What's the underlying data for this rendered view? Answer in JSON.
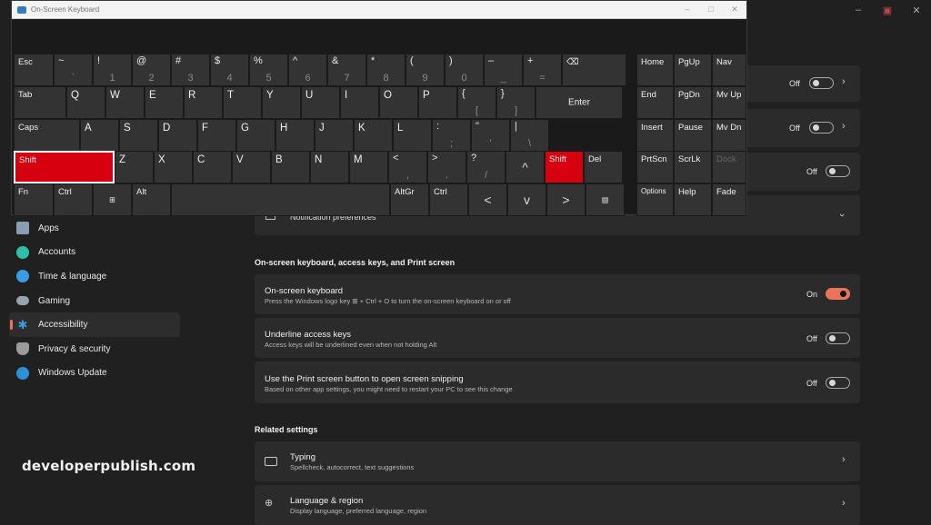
{
  "osk": {
    "title": "On-Screen Keyboard",
    "controls": {
      "minimize": "–",
      "maximize": "□",
      "close": "✕"
    },
    "rows": [
      [
        {
          "label": "Esc"
        },
        {
          "upper": "~",
          "lower": "`"
        },
        {
          "upper": "!",
          "lower": "1"
        },
        {
          "upper": "@",
          "lower": "2"
        },
        {
          "upper": "#",
          "lower": "3"
        },
        {
          "upper": "$",
          "lower": "4"
        },
        {
          "upper": "%",
          "lower": "5"
        },
        {
          "upper": "^",
          "lower": "6"
        },
        {
          "upper": "&",
          "lower": "7"
        },
        {
          "upper": "*",
          "lower": "8"
        },
        {
          "upper": "(",
          "lower": "9"
        },
        {
          "upper": ")",
          "lower": "0"
        },
        {
          "upper": "–",
          "lower": "_"
        },
        {
          "upper": "+",
          "lower": "="
        },
        {
          "label": "⌫",
          "icon": "backspace-icon"
        }
      ],
      [
        {
          "label": "Tab"
        },
        {
          "label": "Q"
        },
        {
          "label": "W"
        },
        {
          "label": "E"
        },
        {
          "label": "R"
        },
        {
          "label": "T"
        },
        {
          "label": "Y"
        },
        {
          "label": "U"
        },
        {
          "label": "I"
        },
        {
          "label": "O"
        },
        {
          "label": "P"
        },
        {
          "upper": "{",
          "lower": "["
        },
        {
          "upper": "}",
          "lower": "]"
        },
        {
          "label": "Enter"
        }
      ],
      [
        {
          "label": "Caps"
        },
        {
          "label": "A"
        },
        {
          "label": "S"
        },
        {
          "label": "D"
        },
        {
          "label": "F"
        },
        {
          "label": "G"
        },
        {
          "label": "H"
        },
        {
          "label": "J"
        },
        {
          "label": "K"
        },
        {
          "label": "L"
        },
        {
          "upper": ":",
          "lower": ";"
        },
        {
          "upper": "\"",
          "lower": "'"
        },
        {
          "upper": "|",
          "lower": "\\"
        }
      ],
      [
        {
          "label": "Shift",
          "state": "pressed"
        },
        {
          "label": "Z"
        },
        {
          "label": "X"
        },
        {
          "label": "C"
        },
        {
          "label": "V"
        },
        {
          "label": "B"
        },
        {
          "label": "N"
        },
        {
          "label": "M"
        },
        {
          "upper": "<",
          "lower": ","
        },
        {
          "upper": ">",
          "lower": "."
        },
        {
          "upper": "?",
          "lower": "/"
        },
        {
          "label": "^",
          "icon": "arrow-up-icon"
        },
        {
          "label": "Shift",
          "state": "pressed"
        },
        {
          "label": "Del"
        }
      ],
      [
        {
          "label": "Fn"
        },
        {
          "label": "Ctrl"
        },
        {
          "label": "⊞",
          "icon": "windows-icon"
        },
        {
          "label": "Alt"
        },
        {
          "label": "",
          "icon": "space"
        },
        {
          "label": "AltGr"
        },
        {
          "label": "Ctrl"
        },
        {
          "label": "<",
          "icon": "arrow-left-icon"
        },
        {
          "label": "v",
          "icon": "arrow-down-icon"
        },
        {
          "label": ">",
          "icon": "arrow-right-icon"
        },
        {
          "label": "▤",
          "icon": "menu-key-icon"
        }
      ]
    ],
    "nav_keys": [
      [
        "Home",
        "PgUp",
        "Nav"
      ],
      [
        "End",
        "PgDn",
        "Mv Up"
      ],
      [
        "Insert",
        "Pause",
        "Mv Dn"
      ],
      [
        "PrtScn",
        "ScrLk",
        "Dock"
      ],
      [
        "Options",
        "Help",
        "Fade"
      ]
    ]
  },
  "window_controls": {
    "minimize": "–",
    "restore": "▣",
    "close": "✕"
  },
  "top_cards": [
    {
      "state": "Off",
      "toggle": false,
      "chevron": "right"
    },
    {
      "state": "Off",
      "toggle": false,
      "chevron": "right"
    },
    {
      "state": "Off",
      "toggle": false
    },
    {
      "title": "Notification preferences",
      "chevron": "down"
    }
  ],
  "sidebar": {
    "items": [
      {
        "label": "Apps",
        "color": "#8b9db5"
      },
      {
        "label": "Accounts",
        "color": "#2fbfa6"
      },
      {
        "label": "Time & language",
        "color": "#3a9be0"
      },
      {
        "label": "Gaming",
        "color": "#9aa3ad"
      },
      {
        "label": "Accessibility",
        "color": "#3a9be0",
        "active": true
      },
      {
        "label": "Privacy & security",
        "color": "#9a9a9a"
      },
      {
        "label": "Windows Update",
        "color": "#2d8fd6"
      }
    ]
  },
  "section": {
    "heading": "On-screen keyboard, access keys, and Print screen",
    "items": [
      {
        "title": "On-screen keyboard",
        "subtitle": "Press the Windows logo key ⊞ + Ctrl + O to turn the on-screen keyboard on or off",
        "state": "On",
        "toggle": true
      },
      {
        "title": "Underline access keys",
        "subtitle": "Access keys will be underlined even when not holding Alt",
        "state": "Off",
        "toggle": false
      },
      {
        "title": "Use the Print screen button to open screen snipping",
        "subtitle": "Based on other app settings, you might need to restart your PC to see this change",
        "state": "Off",
        "toggle": false
      }
    ]
  },
  "related": {
    "heading": "Related settings",
    "items": [
      {
        "title": "Typing",
        "subtitle": "Spellcheck, autocorrect, text suggestions"
      },
      {
        "title": "Language & region",
        "subtitle": "Display language, preferred language, region"
      }
    ]
  },
  "watermark": "developerpublish.com",
  "colors": {
    "accent": "#e9745a",
    "pressed_key": "#d6000f",
    "key": "#333333",
    "background": "#202020"
  }
}
